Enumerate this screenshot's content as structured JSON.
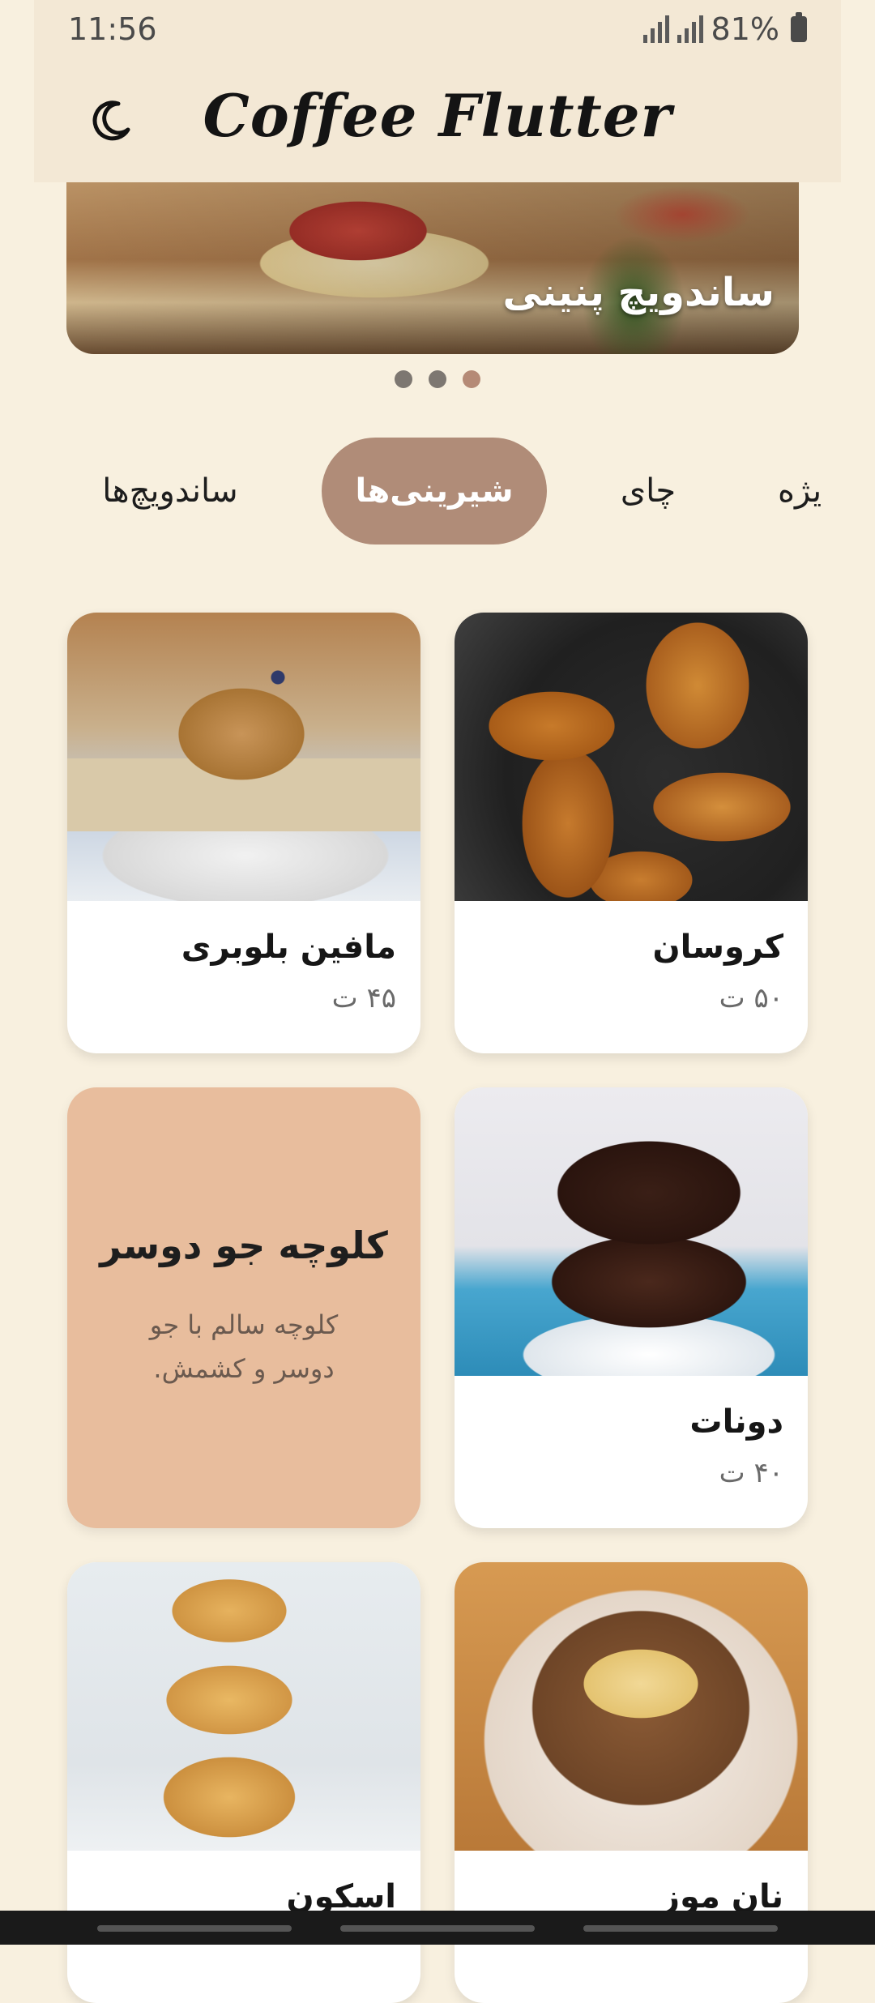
{
  "status": {
    "time": "11:56",
    "battery": "81%"
  },
  "app": {
    "title": "Coffee Flutter",
    "theme_icon": "moon-icon"
  },
  "banner": {
    "title": "ساندویچ پنینی",
    "dots": 3,
    "active_dot": 3
  },
  "tabs": [
    {
      "label": "ساندویچ‌ها"
    },
    {
      "label": "شیرینی‌ها",
      "active": true
    },
    {
      "label": "چای"
    },
    {
      "label": "یژه"
    }
  ],
  "products": [
    {
      "name": "کروسان",
      "price": "۵۰ ت"
    },
    {
      "name": "مافین بلوبری",
      "price": "۴۵ ت"
    },
    {
      "name": "دونات",
      "price": "۴۰ ت"
    },
    {
      "name": "نان موز"
    },
    {
      "name": "اسکون"
    }
  ],
  "promo": {
    "title": "کلوچه جو دوسر",
    "description": "کلوچه سالم با جو دوسر و کشمش."
  },
  "colors": {
    "background": "#f8f0df",
    "accent": "#b08c78",
    "promo": "#e8bd9d"
  }
}
